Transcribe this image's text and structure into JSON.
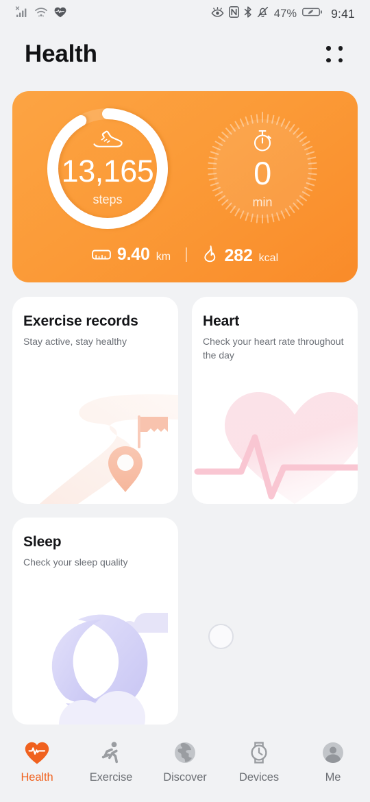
{
  "status_bar": {
    "signal_icon": "signal-bars-no-service-icon",
    "wifi_icon": "wifi-icon",
    "heartrate_icon": "heart-pulse-icon",
    "eyecomfort_icon": "eye-comfort-icon",
    "nfc_icon": "nfc-icon",
    "bluetooth_icon": "bluetooth-icon",
    "silent_icon": "bell-muted-icon",
    "battery_percent": "47%",
    "battery_icon": "battery-icon",
    "time": "9:41"
  },
  "header": {
    "title": "Health",
    "menu_icon": "grid-dots-menu-icon"
  },
  "summary": {
    "accent_color": "#F98B29",
    "steps": {
      "icon": "running-shoe-icon",
      "value": "13,165",
      "unit": "steps",
      "progress_percent": 92
    },
    "exercise_time": {
      "icon": "stopwatch-icon",
      "value": "0",
      "unit": "min",
      "progress_percent": 0
    },
    "distance": {
      "icon": "ruler-icon",
      "value": "9.40",
      "unit": "km"
    },
    "calories": {
      "icon": "flame-icon",
      "value": "282",
      "unit": "kcal"
    }
  },
  "cards": [
    {
      "title": "Exercise records",
      "subtitle": "Stay active, stay healthy",
      "art": "route-path-flag-pin-illustration",
      "art_color": "#F9D6C6"
    },
    {
      "title": "Heart",
      "subtitle": "Check your heart rate throughout the day",
      "art": "heart-ecg-illustration",
      "art_color": "#FADEE4"
    },
    {
      "title": "Sleep",
      "subtitle": "Check your sleep quality",
      "art": "crescent-moon-clouds-illustration",
      "art_color": "#D5D4F4"
    }
  ],
  "loading": {
    "spinner_icon": "loading-spinner-icon"
  },
  "bottom_nav": {
    "active_color": "#F0611E",
    "items": [
      {
        "label": "Health",
        "icon": "heart-pulse-icon",
        "active": true
      },
      {
        "label": "Exercise",
        "icon": "running-person-icon",
        "active": false
      },
      {
        "label": "Discover",
        "icon": "globe-icon",
        "active": false
      },
      {
        "label": "Devices",
        "icon": "smartwatch-icon",
        "active": false
      },
      {
        "label": "Me",
        "icon": "person-avatar-icon",
        "active": false
      }
    ]
  }
}
